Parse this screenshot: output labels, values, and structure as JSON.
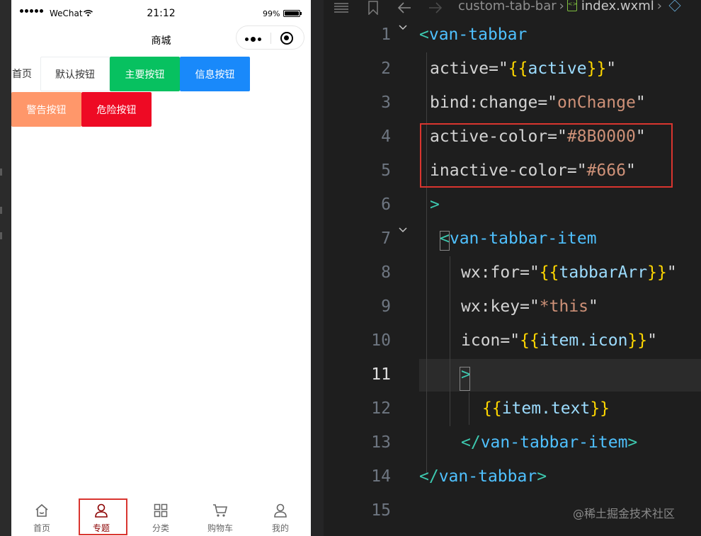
{
  "simulator": {
    "status_bar": {
      "carrier": "WeChat",
      "time": "21:12",
      "battery": "99%",
      "battery_level": 0.99
    },
    "nav": {
      "title": "商城"
    },
    "home_label": "首页",
    "buttons": {
      "default": "默认按钮",
      "primary": "主要按钮",
      "info": "信息按钮",
      "warning": "警告按钮",
      "danger": "危险按钮"
    },
    "tabbar": {
      "active_color": "#8B0000",
      "inactive_color": "#666",
      "items": [
        {
          "label": "首页",
          "icon": "home-icon"
        },
        {
          "label": "专题",
          "icon": "user-icon",
          "active": true
        },
        {
          "label": "分类",
          "icon": "apps-icon"
        },
        {
          "label": "购物车",
          "icon": "cart-icon"
        },
        {
          "label": "我的",
          "icon": "user-icon"
        }
      ]
    }
  },
  "editor": {
    "breadcrumb": {
      "folder": "custom-tab-bar",
      "file": "index.wxml"
    },
    "current_line": 11,
    "lines": [
      {
        "n": "1"
      },
      {
        "n": "2"
      },
      {
        "n": "3"
      },
      {
        "n": "4"
      },
      {
        "n": "5"
      },
      {
        "n": "6"
      },
      {
        "n": "7"
      },
      {
        "n": "8"
      },
      {
        "n": "9"
      },
      {
        "n": "10"
      },
      {
        "n": "11"
      },
      {
        "n": "12"
      },
      {
        "n": "13"
      },
      {
        "n": "14"
      },
      {
        "n": "15"
      }
    ],
    "code": {
      "l1_tag": "van-tabbar",
      "l2_attr": "active",
      "l2_var": "active",
      "l3_attr": "bind:change",
      "l3_val": "onChange",
      "l4_attr": "active-color",
      "l4_val": "#8B0000",
      "l5_attr": "inactive-color",
      "l5_val": "#666",
      "l7_tag": "van-tabbar-item",
      "l8_attr": "wx:for",
      "l8_var": "tabbarArr",
      "l9_attr": "wx:key",
      "l9_val": "*this",
      "l10_attr": "icon",
      "l10_var": "item.icon",
      "l12_var": "item.text",
      "l13_tag": "van-tabbar-item",
      "l14_tag": "van-tabbar"
    },
    "watermark": "@稀土掘金技术社区"
  }
}
